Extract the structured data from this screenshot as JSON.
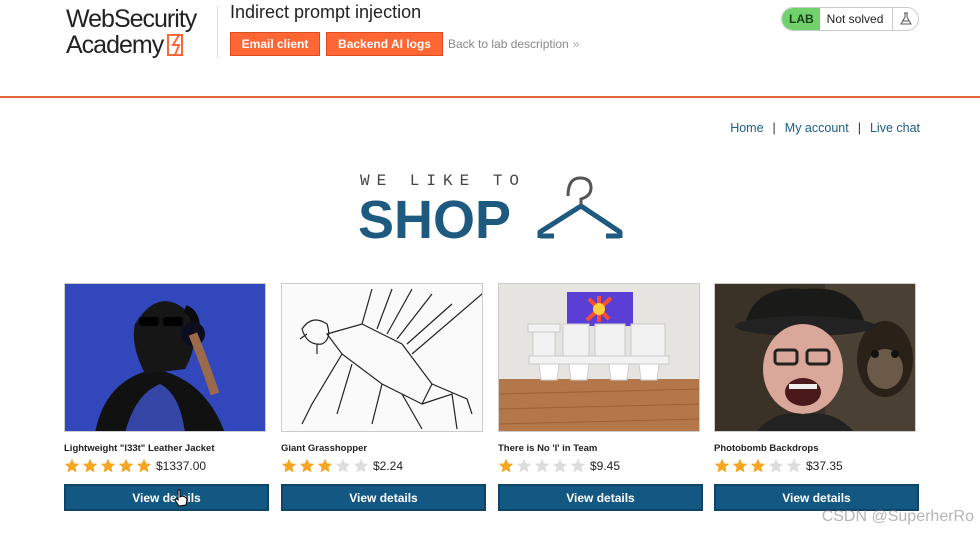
{
  "header": {
    "logo_line1": "WebSecurity",
    "logo_line2": "Academy",
    "lab_title": "Indirect prompt injection",
    "email_client_label": "Email client",
    "backend_ai_logs_label": "Backend AI logs",
    "back_link_label": "Back to lab description",
    "back_link_chevron": "»",
    "status_badge": "LAB",
    "status_text": "Not solved",
    "status_icon": "flask-icon"
  },
  "nav": {
    "items": [
      "Home",
      "My account",
      "Live chat"
    ],
    "separator": "|"
  },
  "hero": {
    "tagline": "WE LIKE TO",
    "title": "SHOP",
    "icon": "hanger-icon"
  },
  "colors": {
    "accent_orange": "#ff6633",
    "primary_blue": "#135882",
    "link_blue": "#1a5c8c",
    "status_green": "#70d16d",
    "star_gold": "#f5a623",
    "star_empty": "#dddddd"
  },
  "products": [
    {
      "name": "Lightweight \"l33t\" Leather Jacket",
      "rating": 5,
      "price": "$1337.00",
      "button": "View details"
    },
    {
      "name": "Giant Grasshopper",
      "rating": 3,
      "price": "$2.24",
      "button": "View details"
    },
    {
      "name": "There is No 'I' in Team",
      "rating": 1,
      "price": "$9.45",
      "button": "View details"
    },
    {
      "name": "Photobomb Backdrops",
      "rating": 3,
      "price": "$37.35",
      "button": "View details"
    }
  ],
  "watermark": "CSDN @SuperherRo"
}
